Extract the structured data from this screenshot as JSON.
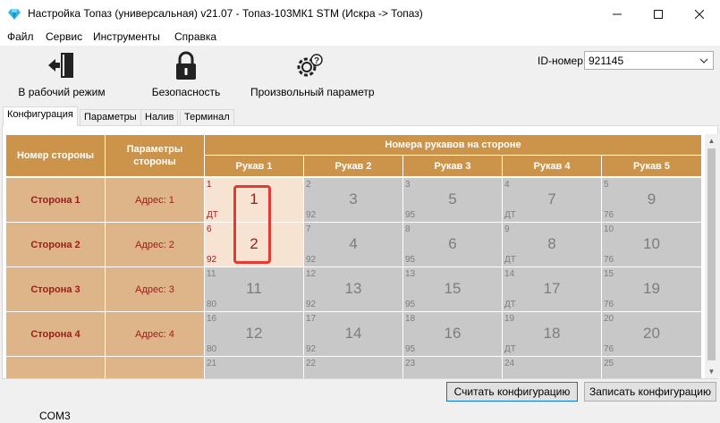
{
  "window": {
    "title": "Настройка Топаз (универсальная) v21.07 - Топаз-103МК1 STM (Искра -> Топаз)",
    "icon": "diamond-app-icon",
    "controls": [
      "minimize-icon",
      "maximize-icon",
      "close-icon"
    ]
  },
  "menu": [
    "Файл",
    "Сервис",
    "Инструменты",
    "Справка"
  ],
  "toolbar": {
    "work_mode": "В рабочий режим",
    "security": "Безопасность",
    "custom_param": "Произвольный параметр",
    "id_label": "ID-номер",
    "id_value": "921145"
  },
  "tabs": [
    "Конфигурация",
    "Параметры",
    "Налив",
    "Терминал"
  ],
  "grid": {
    "col_side_number": "Номер стороны",
    "col_side_params": "Параметры стороны",
    "col_nozzles_group": "Номера рукавов на стороне",
    "nozzle_headers": [
      "Рукав 1",
      "Рукав 2",
      "Рукав 3",
      "Рукав 4",
      "Рукав 5"
    ],
    "rows": [
      {
        "side": "Сторона 1",
        "addr": "Адрес: 1",
        "nozzles": [
          {
            "id": "1",
            "fuel": "ДТ",
            "num": "1",
            "active": true
          },
          {
            "id": "2",
            "fuel": "92",
            "num": "3",
            "active": false
          },
          {
            "id": "3",
            "fuel": "95",
            "num": "5",
            "active": false
          },
          {
            "id": "4",
            "fuel": "ДТ",
            "num": "7",
            "active": false
          },
          {
            "id": "5",
            "fuel": "76",
            "num": "9",
            "active": false
          }
        ]
      },
      {
        "side": "Сторона 2",
        "addr": "Адрес: 2",
        "nozzles": [
          {
            "id": "6",
            "fuel": "92",
            "num": "2",
            "active": true
          },
          {
            "id": "7",
            "fuel": "92",
            "num": "4",
            "active": false
          },
          {
            "id": "8",
            "fuel": "95",
            "num": "6",
            "active": false
          },
          {
            "id": "9",
            "fuel": "ДТ",
            "num": "8",
            "active": false
          },
          {
            "id": "10",
            "fuel": "76",
            "num": "10",
            "active": false
          }
        ]
      },
      {
        "side": "Сторона 3",
        "addr": "Адрес: 3",
        "nozzles": [
          {
            "id": "11",
            "fuel": "80",
            "num": "11",
            "active": false
          },
          {
            "id": "12",
            "fuel": "92",
            "num": "13",
            "active": false
          },
          {
            "id": "13",
            "fuel": "95",
            "num": "15",
            "active": false
          },
          {
            "id": "14",
            "fuel": "ДТ",
            "num": "17",
            "active": false
          },
          {
            "id": "15",
            "fuel": "76",
            "num": "19",
            "active": false
          }
        ]
      },
      {
        "side": "Сторона 4",
        "addr": "Адрес: 4",
        "nozzles": [
          {
            "id": "16",
            "fuel": "80",
            "num": "12",
            "active": false
          },
          {
            "id": "17",
            "fuel": "92",
            "num": "14",
            "active": false
          },
          {
            "id": "18",
            "fuel": "95",
            "num": "16",
            "active": false
          },
          {
            "id": "19",
            "fuel": "ДТ",
            "num": "18",
            "active": false
          },
          {
            "id": "20",
            "fuel": "76",
            "num": "20",
            "active": false
          }
        ]
      },
      {
        "side": "",
        "addr": "",
        "nozzles": [
          {
            "id": "21",
            "fuel": "",
            "num": "",
            "active": false
          },
          {
            "id": "22",
            "fuel": "",
            "num": "",
            "active": false
          },
          {
            "id": "23",
            "fuel": "",
            "num": "",
            "active": false
          },
          {
            "id": "24",
            "fuel": "",
            "num": "",
            "active": false
          },
          {
            "id": "25",
            "fuel": "",
            "num": "",
            "active": false
          }
        ]
      }
    ]
  },
  "buttons": {
    "read_config": "Считать конфигурацию",
    "write_config": "Записать конфигурацию"
  },
  "status": {
    "port": "COM3"
  },
  "colors": {
    "header": "#cc944b",
    "side_cell": "#ddb588",
    "nozzle_inactive": "#c8c8c8",
    "nozzle_active": "#f6e3d1",
    "side_text": "#9b1c1c",
    "highlight": "#e53935"
  }
}
